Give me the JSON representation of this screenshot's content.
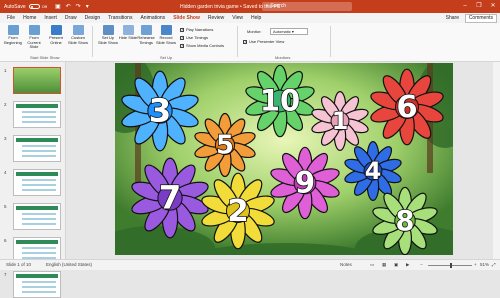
{
  "titlebar": {
    "autosave": "AutoSave",
    "autosave_state": "Off",
    "doc_title": "Hidden garden trivia game  •  Saved to this PC",
    "search_placeholder": "Search",
    "minimize": "–",
    "restore": "❐",
    "close": "✕"
  },
  "tabs": [
    "File",
    "Home",
    "Insert",
    "Draw",
    "Design",
    "Transitions",
    "Animations",
    "Slide Show",
    "Review",
    "View",
    "Help"
  ],
  "tabs_right": {
    "share": "Share",
    "comments": "Comments"
  },
  "ribbon": {
    "buttons": [
      {
        "label": "From Beginning",
        "icon": "play-from-start-icon",
        "color": "#6a9fd4"
      },
      {
        "label": "From Current Slide",
        "icon": "play-current-icon",
        "color": "#6a9fd4"
      },
      {
        "label": "Present Online",
        "icon": "present-online-icon",
        "color": "#3a7cc7"
      },
      {
        "label": "Custom Slide Show",
        "icon": "custom-show-icon",
        "color": "#7aa7d8"
      },
      {
        "label": "Set Up Slide Show",
        "icon": "setup-show-icon",
        "color": "#5d8fc4"
      },
      {
        "label": "Hide Slide",
        "icon": "hide-slide-icon",
        "color": "#8fb2dc"
      },
      {
        "label": "Rehearse Timings",
        "icon": "rehearse-icon",
        "color": "#6fa0d6"
      },
      {
        "label": "Record Slide Show",
        "icon": "record-icon",
        "color": "#4a86c8"
      }
    ],
    "checkboxes": [
      {
        "label": "Play Narrations",
        "checked": true
      },
      {
        "label": "Use Timings",
        "checked": true
      },
      {
        "label": "Show Media Controls",
        "checked": true
      }
    ],
    "monitor_label": "Monitor:",
    "monitor_value": "Automatic",
    "presenter_view": "Use Presenter View",
    "groups": [
      "Start Slide Show",
      "Set Up",
      "Monitors"
    ]
  },
  "slide_numbers": [
    "1",
    "2",
    "3",
    "4",
    "5",
    "6",
    "7"
  ],
  "flowers": [
    {
      "num": "3",
      "color": "#1e90ff",
      "petal": "#4fb2ff"
    },
    {
      "num": "10",
      "color": "#3cb371",
      "petal": "#66d26a"
    },
    {
      "num": "1",
      "color": "#e8a0b8",
      "petal": "#f6c3d2"
    },
    {
      "num": "6",
      "color": "#d0302a",
      "petal": "#e8463c"
    },
    {
      "num": "5",
      "color": "#e07b1a",
      "petal": "#f39c3a"
    },
    {
      "num": "4",
      "color": "#1f4fc4",
      "petal": "#2f6de6"
    },
    {
      "num": "7",
      "color": "#7a3cc4",
      "petal": "#9a5ae0"
    },
    {
      "num": "2",
      "color": "#e0c21a",
      "petal": "#f2dc3a"
    },
    {
      "num": "9",
      "color": "#c03bb8",
      "petal": "#df5fd6"
    },
    {
      "num": "8",
      "color": "#6dbb3a",
      "petal": "#a7e07a"
    }
  ],
  "status": {
    "slide": "Slide 1 of 10",
    "language": "English (United States)",
    "notes": "Notes",
    "zoom": "51%"
  }
}
